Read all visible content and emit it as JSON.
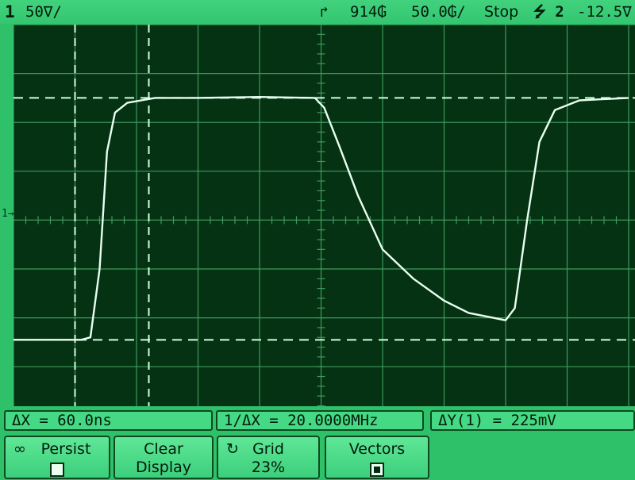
{
  "status_bar": {
    "channel": "1",
    "volts_per_div": "50∇/",
    "trigger_marker": "↱",
    "horizontal_delay": "914₲",
    "time_per_div": "50.0₲/",
    "run_state": "Stop",
    "trigger_info": "⭍ 2",
    "trigger_level": "-12.5∇"
  },
  "side_marker": "1→",
  "measurements": {
    "delta_x": "ΔX = 60.0ns",
    "inverse_delta_x": "1/ΔX = 20.0000MHz",
    "delta_y": "ΔY(1) = 225mV"
  },
  "softkeys": {
    "persist": {
      "icon": "∞",
      "label": "Persist",
      "checked": false
    },
    "clear_display": {
      "line1": "Clear",
      "line2": "Display"
    },
    "grid": {
      "icon": "↻",
      "label": "Grid",
      "value": "23%"
    },
    "vectors": {
      "label": "Vectors",
      "checked": true
    }
  },
  "colors": {
    "bezel": "#2fc06a",
    "screen": "#053213",
    "graticule": "#3e9a5c",
    "trace": "#e8fff0",
    "cursor": "#cfffe0"
  },
  "waveform": {
    "description_units": "x in divisions (0-10), y in divisions from bottom (0-8)",
    "points": [
      [
        0,
        1.55
      ],
      [
        1.1,
        1.55
      ],
      [
        1.25,
        1.6
      ],
      [
        1.4,
        3.0
      ],
      [
        1.52,
        5.4
      ],
      [
        1.65,
        6.2
      ],
      [
        1.85,
        6.4
      ],
      [
        2.3,
        6.5
      ],
      [
        3.0,
        6.5
      ],
      [
        4.0,
        6.52
      ],
      [
        4.9,
        6.5
      ],
      [
        5.05,
        6.3
      ],
      [
        5.3,
        5.5
      ],
      [
        5.6,
        4.5
      ],
      [
        6.0,
        3.4
      ],
      [
        6.5,
        2.8
      ],
      [
        7.0,
        2.35
      ],
      [
        7.4,
        2.1
      ],
      [
        7.8,
        2.0
      ],
      [
        8.0,
        1.95
      ],
      [
        8.15,
        2.2
      ],
      [
        8.35,
        4.0
      ],
      [
        8.55,
        5.6
      ],
      [
        8.8,
        6.25
      ],
      [
        9.2,
        6.45
      ],
      [
        10,
        6.5
      ]
    ],
    "cursor_x": [
      1.0,
      2.2
    ],
    "cursor_y": [
      1.55,
      6.5
    ]
  }
}
